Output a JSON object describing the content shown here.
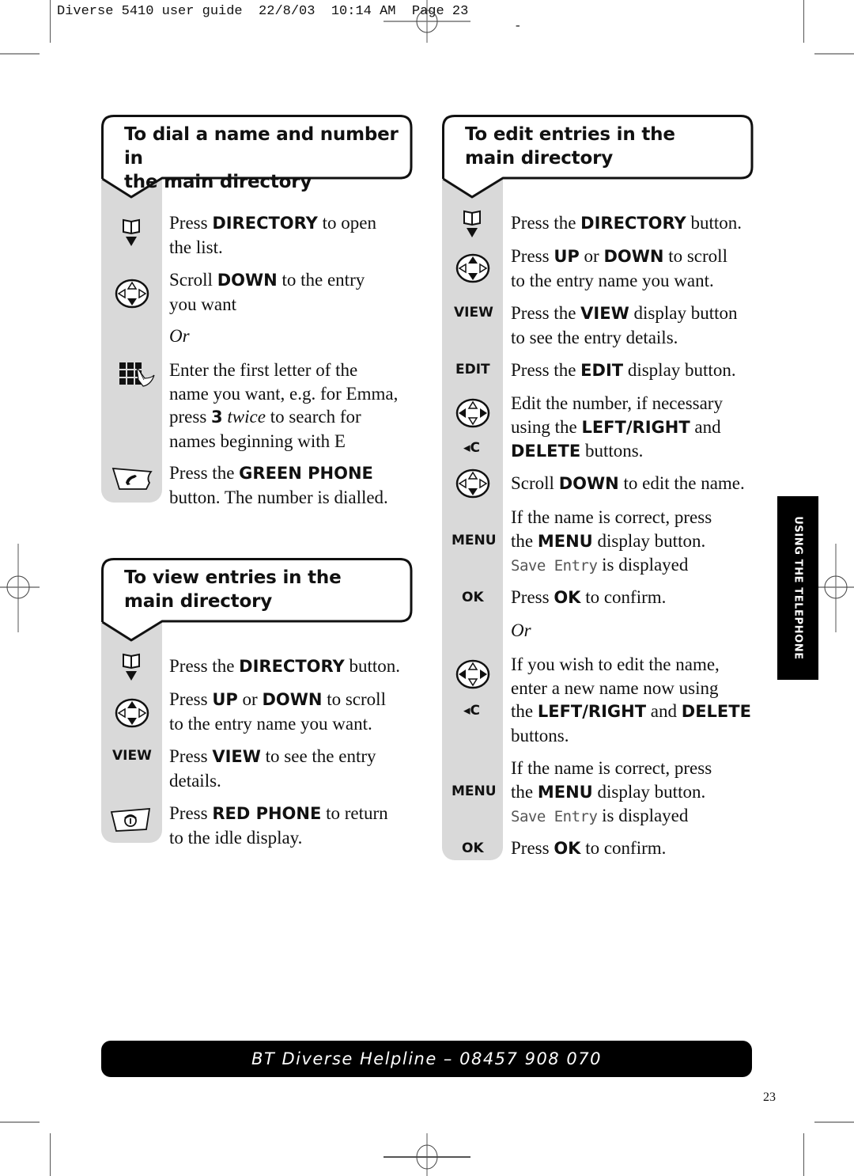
{
  "print_header": {
    "text": "Diverse 5410 user guide  22/8/03  10:14 AM  Page 23",
    "trailing_mark": "-"
  },
  "sections": {
    "dial": {
      "title_line1": "To dial a name and number in",
      "title_line2": "the main directory",
      "steps": [
        {
          "icon": "directory-icon",
          "parts": [
            "Press ",
            "DIRECTORY",
            " to open",
            "the list."
          ]
        },
        {
          "icon": "navigation-down-icon",
          "parts": [
            "Scroll ",
            "DOWN",
            " to the entry",
            "you want"
          ]
        },
        {
          "icon": "none",
          "or": "Or"
        },
        {
          "icon": "keypad-icon",
          "parts": [
            "Enter the first letter of the",
            "name you want, e.g. for Emma,",
            "press ",
            "3",
            " ",
            "twice",
            " to search for",
            "names beginning with E"
          ]
        },
        {
          "icon": "green-phone-icon",
          "parts": [
            "Press the ",
            "GREEN PHONE",
            "button. The number is dialled."
          ]
        }
      ]
    },
    "view": {
      "title_line1": "To view entries in the",
      "title_line2": "main directory",
      "steps": [
        {
          "icon": "directory-icon",
          "parts": [
            "Press the ",
            "DIRECTORY",
            " button."
          ]
        },
        {
          "icon": "navigation-up-down-icon",
          "parts": [
            "Press ",
            "UP",
            " or ",
            "DOWN",
            " to scroll",
            "to the entry name you want."
          ]
        },
        {
          "icon": "VIEW",
          "parts": [
            "Press ",
            "VIEW",
            " to see the entry",
            "details."
          ]
        },
        {
          "icon": "red-phone-icon",
          "parts": [
            "Press ",
            "RED PHONE",
            " to return",
            "to the idle display."
          ]
        }
      ]
    },
    "edit": {
      "title_line1": "To edit entries in the",
      "title_line2": "main directory",
      "steps": [
        {
          "icon": "directory-icon",
          "parts": [
            "Press the ",
            "DIRECTORY",
            " button."
          ]
        },
        {
          "icon": "navigation-up-down-icon",
          "parts": [
            "Press ",
            "UP",
            " or ",
            "DOWN",
            " to scroll",
            "to the entry name you want."
          ]
        },
        {
          "icon": "VIEW",
          "parts": [
            "Press the ",
            "VIEW",
            " display button",
            "to see the entry details."
          ]
        },
        {
          "icon": "EDIT",
          "parts": [
            "Press the ",
            "EDIT",
            " display button."
          ]
        },
        {
          "icon": "navigation-left-right-icon",
          "icon2": "◂C",
          "parts": [
            "Edit the number, if necessary",
            "using the ",
            "LEFT/RIGHT",
            " and",
            "DELETE",
            " buttons."
          ]
        },
        {
          "icon": "navigation-down-icon",
          "parts": [
            "Scroll ",
            "DOWN",
            " to edit the name."
          ]
        },
        {
          "icon": "MENU",
          "parts": [
            "If the name is correct, press",
            "the ",
            "MENU",
            " display button.",
            "Save Entry",
            " is displayed"
          ]
        },
        {
          "icon": "OK",
          "parts": [
            "Press ",
            "OK",
            " to confirm."
          ]
        },
        {
          "icon": "none",
          "or": "Or"
        },
        {
          "icon": "navigation-left-right-icon",
          "icon2": "◂C",
          "parts": [
            "If you wish to edit the name,",
            "enter a new name now using",
            "the ",
            "LEFT/RIGHT",
            " and ",
            "DELETE",
            "buttons."
          ]
        },
        {
          "icon": "MENU",
          "parts": [
            "If the name is correct, press",
            "the ",
            "MENU",
            " display button.",
            "Save Entry",
            " is displayed"
          ]
        },
        {
          "icon": "OK",
          "parts": [
            "Press ",
            "OK",
            " to confirm."
          ]
        }
      ]
    }
  },
  "key_labels": {
    "view": "VIEW",
    "edit": "EDIT",
    "menu": "MENU",
    "ok": "OK",
    "delete": "◂C"
  },
  "side_tab": "USING THE TELEPHONE",
  "helpline": "BT Diverse Helpline – 08457 908 070",
  "page_number": "23"
}
